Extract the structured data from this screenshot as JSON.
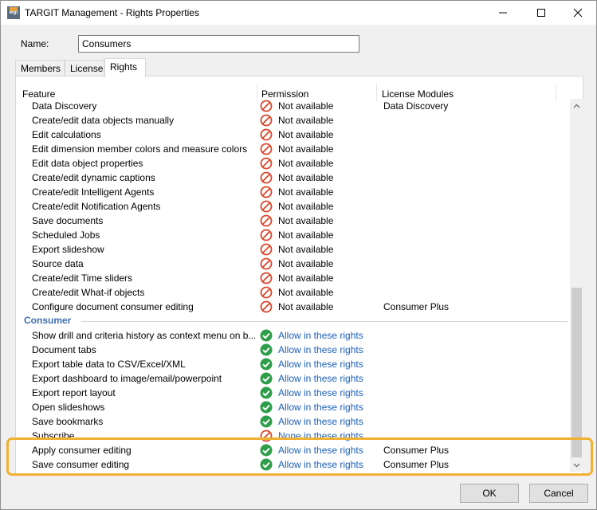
{
  "window": {
    "title": "TARGIT Management - Rights Properties",
    "app_icon_text": "Mgt"
  },
  "form": {
    "name_label": "Name:",
    "name_value": "Consumers"
  },
  "tabs": [
    {
      "label": "Members",
      "active": false
    },
    {
      "label": "License",
      "active": false
    },
    {
      "label": "Rights",
      "active": true
    }
  ],
  "grid": {
    "columns": [
      "Feature",
      "Permission",
      "License Modules"
    ],
    "rows": [
      {
        "kind": "row",
        "feature": "Data Discovery",
        "permission": "Not available",
        "status": "not-available",
        "license": "Data Discovery"
      },
      {
        "kind": "row",
        "feature": "Create/edit data objects manually",
        "permission": "Not available",
        "status": "not-available",
        "license": ""
      },
      {
        "kind": "row",
        "feature": "Edit calculations",
        "permission": "Not available",
        "status": "not-available",
        "license": ""
      },
      {
        "kind": "row",
        "feature": "Edit dimension member colors and measure colors",
        "permission": "Not available",
        "status": "not-available",
        "license": ""
      },
      {
        "kind": "row",
        "feature": "Edit data object properties",
        "permission": "Not available",
        "status": "not-available",
        "license": ""
      },
      {
        "kind": "row",
        "feature": "Create/edit dynamic captions",
        "permission": "Not available",
        "status": "not-available",
        "license": ""
      },
      {
        "kind": "row",
        "feature": "Create/edit Intelligent Agents",
        "permission": "Not available",
        "status": "not-available",
        "license": ""
      },
      {
        "kind": "row",
        "feature": "Create/edit Notification Agents",
        "permission": "Not available",
        "status": "not-available",
        "license": ""
      },
      {
        "kind": "row",
        "feature": "Save documents",
        "permission": "Not available",
        "status": "not-available",
        "license": ""
      },
      {
        "kind": "row",
        "feature": "Scheduled Jobs",
        "permission": "Not available",
        "status": "not-available",
        "license": ""
      },
      {
        "kind": "row",
        "feature": "Export slideshow",
        "permission": "Not available",
        "status": "not-available",
        "license": ""
      },
      {
        "kind": "row",
        "feature": "Source data",
        "permission": "Not available",
        "status": "not-available",
        "license": ""
      },
      {
        "kind": "row",
        "feature": "Create/edit Time sliders",
        "permission": "Not available",
        "status": "not-available",
        "license": ""
      },
      {
        "kind": "row",
        "feature": "Create/edit What-if objects",
        "permission": "Not available",
        "status": "not-available",
        "license": ""
      },
      {
        "kind": "row",
        "feature": "Configure document consumer editing",
        "permission": "Not available",
        "status": "not-available",
        "license": "Consumer Plus"
      },
      {
        "kind": "group",
        "label": "Consumer"
      },
      {
        "kind": "row",
        "feature": "Show drill and criteria history as context menu on b...",
        "permission": "Allow in these rights",
        "status": "allow",
        "license": ""
      },
      {
        "kind": "row",
        "feature": "Document tabs",
        "permission": "Allow in these rights",
        "status": "allow",
        "license": ""
      },
      {
        "kind": "row",
        "feature": "Export table data to CSV/Excel/XML",
        "permission": "Allow in these rights",
        "status": "allow",
        "license": ""
      },
      {
        "kind": "row",
        "feature": "Export dashboard to image/email/powerpoint",
        "permission": "Allow in these rights",
        "status": "allow",
        "license": ""
      },
      {
        "kind": "row",
        "feature": "Export report layout",
        "permission": "Allow in these rights",
        "status": "allow",
        "license": ""
      },
      {
        "kind": "row",
        "feature": "Open slideshows",
        "permission": "Allow in these rights",
        "status": "allow",
        "license": ""
      },
      {
        "kind": "row",
        "feature": "Save bookmarks",
        "permission": "Allow in these rights",
        "status": "allow",
        "license": ""
      },
      {
        "kind": "row",
        "feature": "Subscribe",
        "permission": "None in these rights",
        "status": "none",
        "license": ""
      },
      {
        "kind": "row",
        "feature": "Apply consumer editing",
        "permission": "Allow in these rights",
        "status": "allow",
        "license": "Consumer Plus"
      },
      {
        "kind": "row",
        "feature": "Save consumer editing",
        "permission": "Allow in these rights",
        "status": "allow",
        "license": "Consumer Plus"
      }
    ]
  },
  "buttons": {
    "ok": "OK",
    "cancel": "Cancel"
  },
  "colors": {
    "highlight": "#f0b030",
    "group_label": "#3d6fb0",
    "link_text": "#1b5fb8",
    "allow_icon": "#2e9e4a",
    "deny_icon": "#d9462b"
  }
}
